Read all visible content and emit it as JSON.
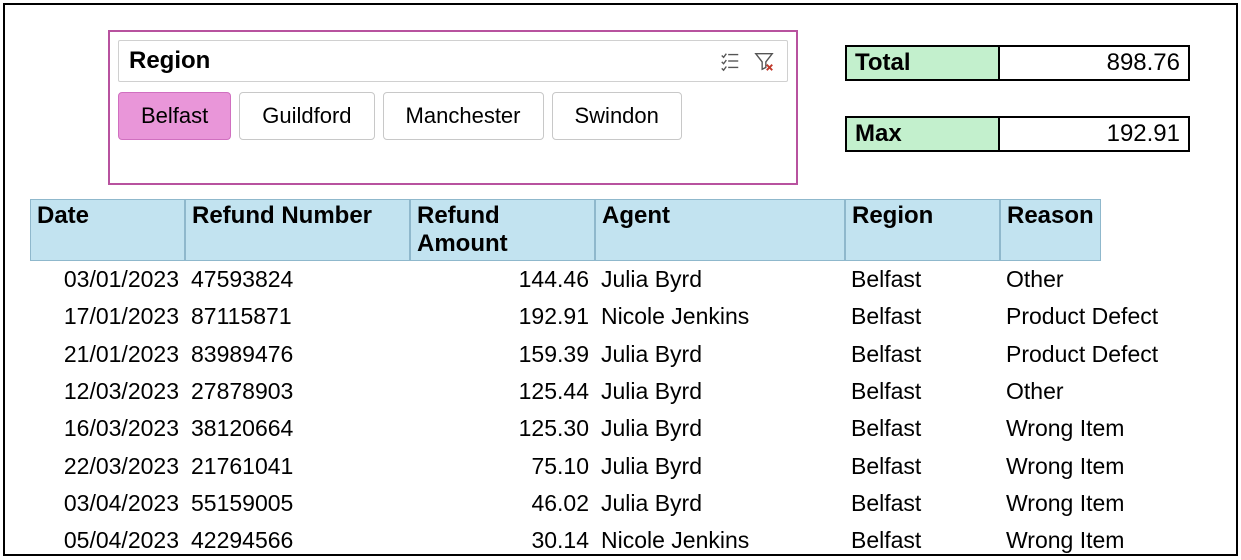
{
  "slicer": {
    "title": "Region",
    "options": [
      {
        "label": "Belfast",
        "selected": true
      },
      {
        "label": "Guildford",
        "selected": false
      },
      {
        "label": "Manchester",
        "selected": false
      },
      {
        "label": "Swindon",
        "selected": false
      }
    ]
  },
  "summary": {
    "total_label": "Total",
    "total_value": "898.76",
    "max_label": "Max",
    "max_value": "192.91"
  },
  "table": {
    "headers": {
      "date": "Date",
      "refund_number": "Refund Number",
      "refund_amount": "Refund Amount",
      "agent": "Agent",
      "region": "Region",
      "reason": "Reason"
    },
    "rows": [
      {
        "date": "03/01/2023",
        "refund_number": "47593824",
        "refund_amount": "144.46",
        "agent": "Julia Byrd",
        "region": "Belfast",
        "reason": "Other"
      },
      {
        "date": "17/01/2023",
        "refund_number": "87115871",
        "refund_amount": "192.91",
        "agent": "Nicole Jenkins",
        "region": "Belfast",
        "reason": "Product Defect"
      },
      {
        "date": "21/01/2023",
        "refund_number": "83989476",
        "refund_amount": "159.39",
        "agent": "Julia Byrd",
        "region": "Belfast",
        "reason": "Product Defect"
      },
      {
        "date": "12/03/2023",
        "refund_number": "27878903",
        "refund_amount": "125.44",
        "agent": "Julia Byrd",
        "region": "Belfast",
        "reason": "Other"
      },
      {
        "date": "16/03/2023",
        "refund_number": "38120664",
        "refund_amount": "125.30",
        "agent": "Julia Byrd",
        "region": "Belfast",
        "reason": "Wrong Item"
      },
      {
        "date": "22/03/2023",
        "refund_number": "21761041",
        "refund_amount": "75.10",
        "agent": "Julia Byrd",
        "region": "Belfast",
        "reason": "Wrong Item"
      },
      {
        "date": "03/04/2023",
        "refund_number": "55159005",
        "refund_amount": "46.02",
        "agent": "Julia Byrd",
        "region": "Belfast",
        "reason": "Wrong Item"
      },
      {
        "date": "05/04/2023",
        "refund_number": "42294566",
        "refund_amount": "30.14",
        "agent": "Nicole Jenkins",
        "region": "Belfast",
        "reason": "Wrong Item"
      }
    ]
  }
}
